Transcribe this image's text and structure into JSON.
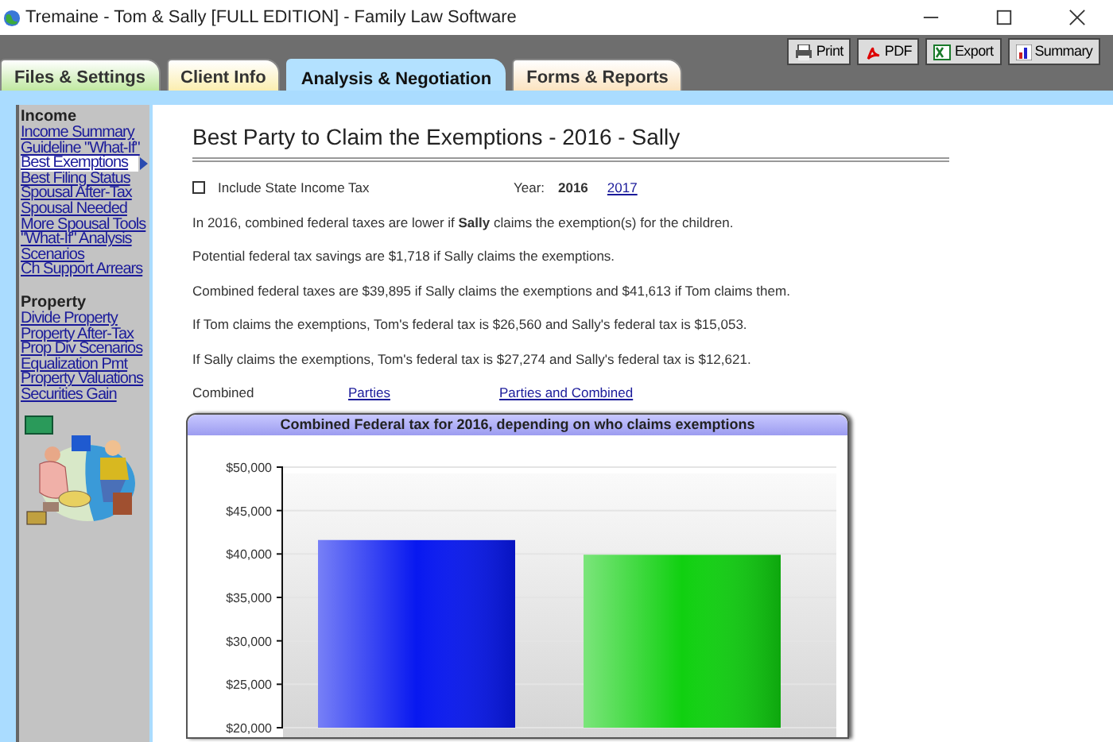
{
  "window": {
    "title": "Tremaine - Tom & Sally [FULL EDITION] - Family Law Software"
  },
  "tabs": [
    {
      "label": "Files & Settings",
      "selected": false,
      "color": "#bfe8a0"
    },
    {
      "label": "Client Info",
      "selected": false,
      "color": "#fbeeb0"
    },
    {
      "label": "Analysis & Negotiation",
      "selected": true,
      "color": "#b3e1ff"
    },
    {
      "label": "Forms & Reports",
      "selected": false,
      "color": "#fbe3c0"
    }
  ],
  "toolbar_buttons": [
    {
      "kind": "print",
      "label": "Print"
    },
    {
      "kind": "pdf",
      "label": "PDF"
    },
    {
      "kind": "export",
      "label": "Export"
    },
    {
      "kind": "summary",
      "label": "Summary"
    }
  ],
  "sidebar": {
    "sections": [
      {
        "heading": "Income",
        "items": [
          {
            "label": "Income Summary",
            "selected": false
          },
          {
            "label": "Guideline \"What-If\"",
            "selected": false
          },
          {
            "label": "Best Exemptions",
            "selected": true
          },
          {
            "label": "Best Filing Status",
            "selected": false
          },
          {
            "label": "Spousal After-Tax",
            "selected": false
          },
          {
            "label": "Spousal Needed",
            "selected": false
          },
          {
            "label": "More Spousal Tools",
            "selected": false
          },
          {
            "label": "\"What-If\" Analysis",
            "selected": false
          },
          {
            "label": "Scenarios",
            "selected": false
          },
          {
            "label": "Ch Support Arrears",
            "selected": false
          }
        ]
      },
      {
        "heading": "Property",
        "items": [
          {
            "label": "Divide Property",
            "selected": false
          },
          {
            "label": "Property After-Tax",
            "selected": false
          },
          {
            "label": "Prop Div Scenarios",
            "selected": false
          },
          {
            "label": "Equalization Pmt",
            "selected": false
          },
          {
            "label": "Property Valuations",
            "selected": false
          },
          {
            "label": "Securities Gain",
            "selected": false
          }
        ]
      }
    ]
  },
  "page": {
    "title": "Best Party to Claim the Exemptions - 2016 - Sally",
    "checkbox": {
      "label": "Include State Income Tax",
      "checked": false
    },
    "year": {
      "label": "Year:",
      "options": [
        {
          "label": "2016",
          "selected": true
        },
        {
          "label": "2017",
          "selected": false
        }
      ]
    },
    "paragraphs": [
      "In 2016, combined federal taxes are lower if **Sally** claims the exemption(s) for the children.",
      "Potential federal tax savings are $1,718 if Sally claims the exemptions.",
      "Combined federal taxes are $39,895 if Sally claims the exemptions and $41,613 if Tom claims them.",
      "If Tom claims the exemptions, Tom's federal tax is $26,560 and Sally's federal tax is $15,053.",
      "If Sally claims the exemptions, Tom's federal tax is $27,274 and Sally's federal tax is $12,621."
    ],
    "view_links": [
      {
        "label": "Combined",
        "selected": true
      },
      {
        "label": "Parties",
        "selected": false
      },
      {
        "label": "Parties and Combined",
        "selected": false
      }
    ],
    "chart": {
      "title": "Combined Federal tax for 2016, depending on who claims exemptions",
      "chart_data": {
        "type": "bar",
        "grid": true,
        "values": [
          41600,
          39900
        ],
        "colors": [
          "#0818f0",
          "#10d010"
        ],
        "ylim": [
          20000,
          50000
        ],
        "yticks": [
          {
            "value": 20000,
            "label": "$20,000"
          },
          {
            "value": 25000,
            "label": "$25,000"
          },
          {
            "value": 30000,
            "label": "$30,000"
          },
          {
            "value": 35000,
            "label": "$35,000"
          },
          {
            "value": 40000,
            "label": "$40,000"
          },
          {
            "value": 45000,
            "label": "$45,000"
          },
          {
            "value": 50000,
            "label": "$50,000"
          }
        ]
      }
    }
  }
}
